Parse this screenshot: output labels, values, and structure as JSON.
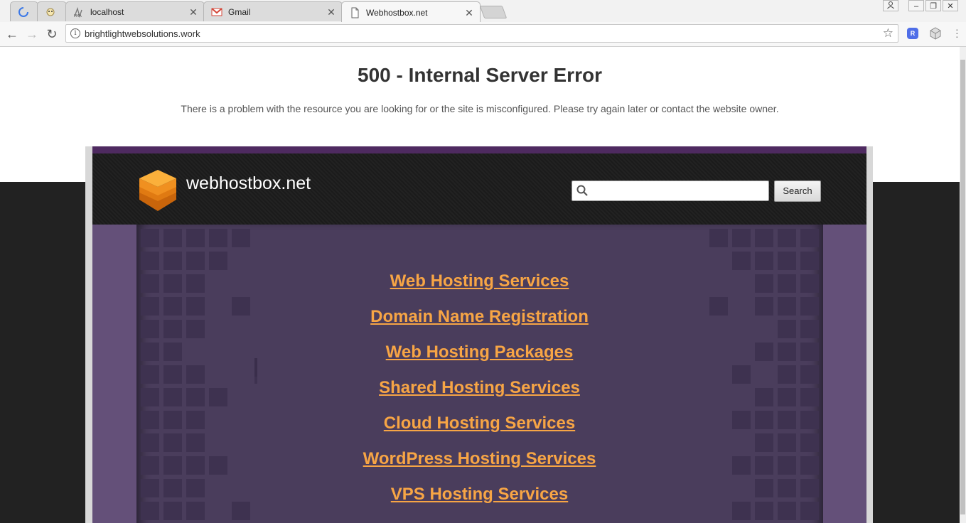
{
  "tabs": [
    {
      "title": "",
      "favicon": "loading-spinner-icon",
      "active": false
    },
    {
      "title": "",
      "favicon": "pma-ghost-icon",
      "active": false
    },
    {
      "title": "localhost",
      "favicon": "phpmyadmin-icon",
      "active": false
    },
    {
      "title": "Gmail",
      "favicon": "gmail-icon",
      "active": false
    },
    {
      "title": "Webhostbox.net",
      "favicon": "page-icon",
      "active": true
    }
  ],
  "toolbar": {
    "url": "brightlightwebsolutions.work",
    "ext_badge": "R"
  },
  "error": {
    "title": "500 - Internal Server Error",
    "message": "There is a problem with the resource you are looking for or the site is misconfigured. Please try again later or contact the website owner."
  },
  "banner": {
    "logo_text": "webhostbox.net",
    "search_button": "Search",
    "search_placeholder": ""
  },
  "links": [
    "Web Hosting Services",
    "Domain Name Registration",
    "Web Hosting Packages",
    "Shared Hosting Services",
    "Cloud Hosting Services",
    "WordPress Hosting Services",
    "VPS Hosting Services"
  ],
  "colors": {
    "link": "#f7a545",
    "content_bg": "#4a3d5c",
    "banner_bg": "#1b1b1b",
    "accent_line": "#4e2a60"
  }
}
